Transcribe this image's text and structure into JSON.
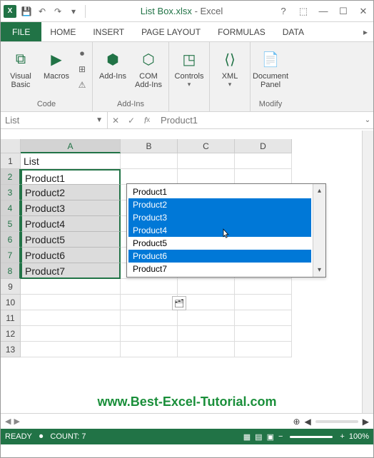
{
  "qat": {
    "title_doc": "List Box.xlsx",
    "title_app": "Excel"
  },
  "tabs": {
    "file": "FILE",
    "home": "HOME",
    "insert": "INSERT",
    "pagelayout": "PAGE LAYOUT",
    "formulas": "FORMULAS",
    "data": "DATA"
  },
  "ribbon": {
    "visual_basic": "Visual\nBasic",
    "macros": "Macros",
    "code_group": "Code",
    "addins": "Add-Ins",
    "com_addins": "COM\nAdd-Ins",
    "addins_group": "Add-Ins",
    "controls": "Controls",
    "xml": "XML",
    "document_panel": "Document\nPanel",
    "modify_group": "Modify"
  },
  "namebox": {
    "name": "List",
    "fx_val": "Product1"
  },
  "columns": [
    "A",
    "B",
    "C",
    "D"
  ],
  "rows": [
    "1",
    "2",
    "3",
    "4",
    "5",
    "6",
    "7",
    "8",
    "9",
    "10",
    "11",
    "12",
    "13"
  ],
  "cells": {
    "a1": "List",
    "a2": "Product1",
    "a3": "Product2",
    "a4": "Product3",
    "a5": "Product4",
    "a6": "Product5",
    "a7": "Product6",
    "a8": "Product7"
  },
  "listbox": {
    "items": [
      "Product1",
      "Product2",
      "Product3",
      "Product4",
      "Product5",
      "Product6",
      "Product7"
    ],
    "selected": [
      false,
      true,
      true,
      true,
      false,
      true,
      false
    ]
  },
  "watermark": "www.Best-Excel-Tutorial.com",
  "statusbar": {
    "ready": "READY",
    "count_label": "COUNT:",
    "count_val": "7",
    "zoom": "100%"
  },
  "chart_data": {
    "type": "table",
    "title": "List",
    "categories": [
      "Product1",
      "Product2",
      "Product3",
      "Product4",
      "Product5",
      "Product6",
      "Product7"
    ],
    "values": [],
    "xlabel": "",
    "ylabel": ""
  }
}
